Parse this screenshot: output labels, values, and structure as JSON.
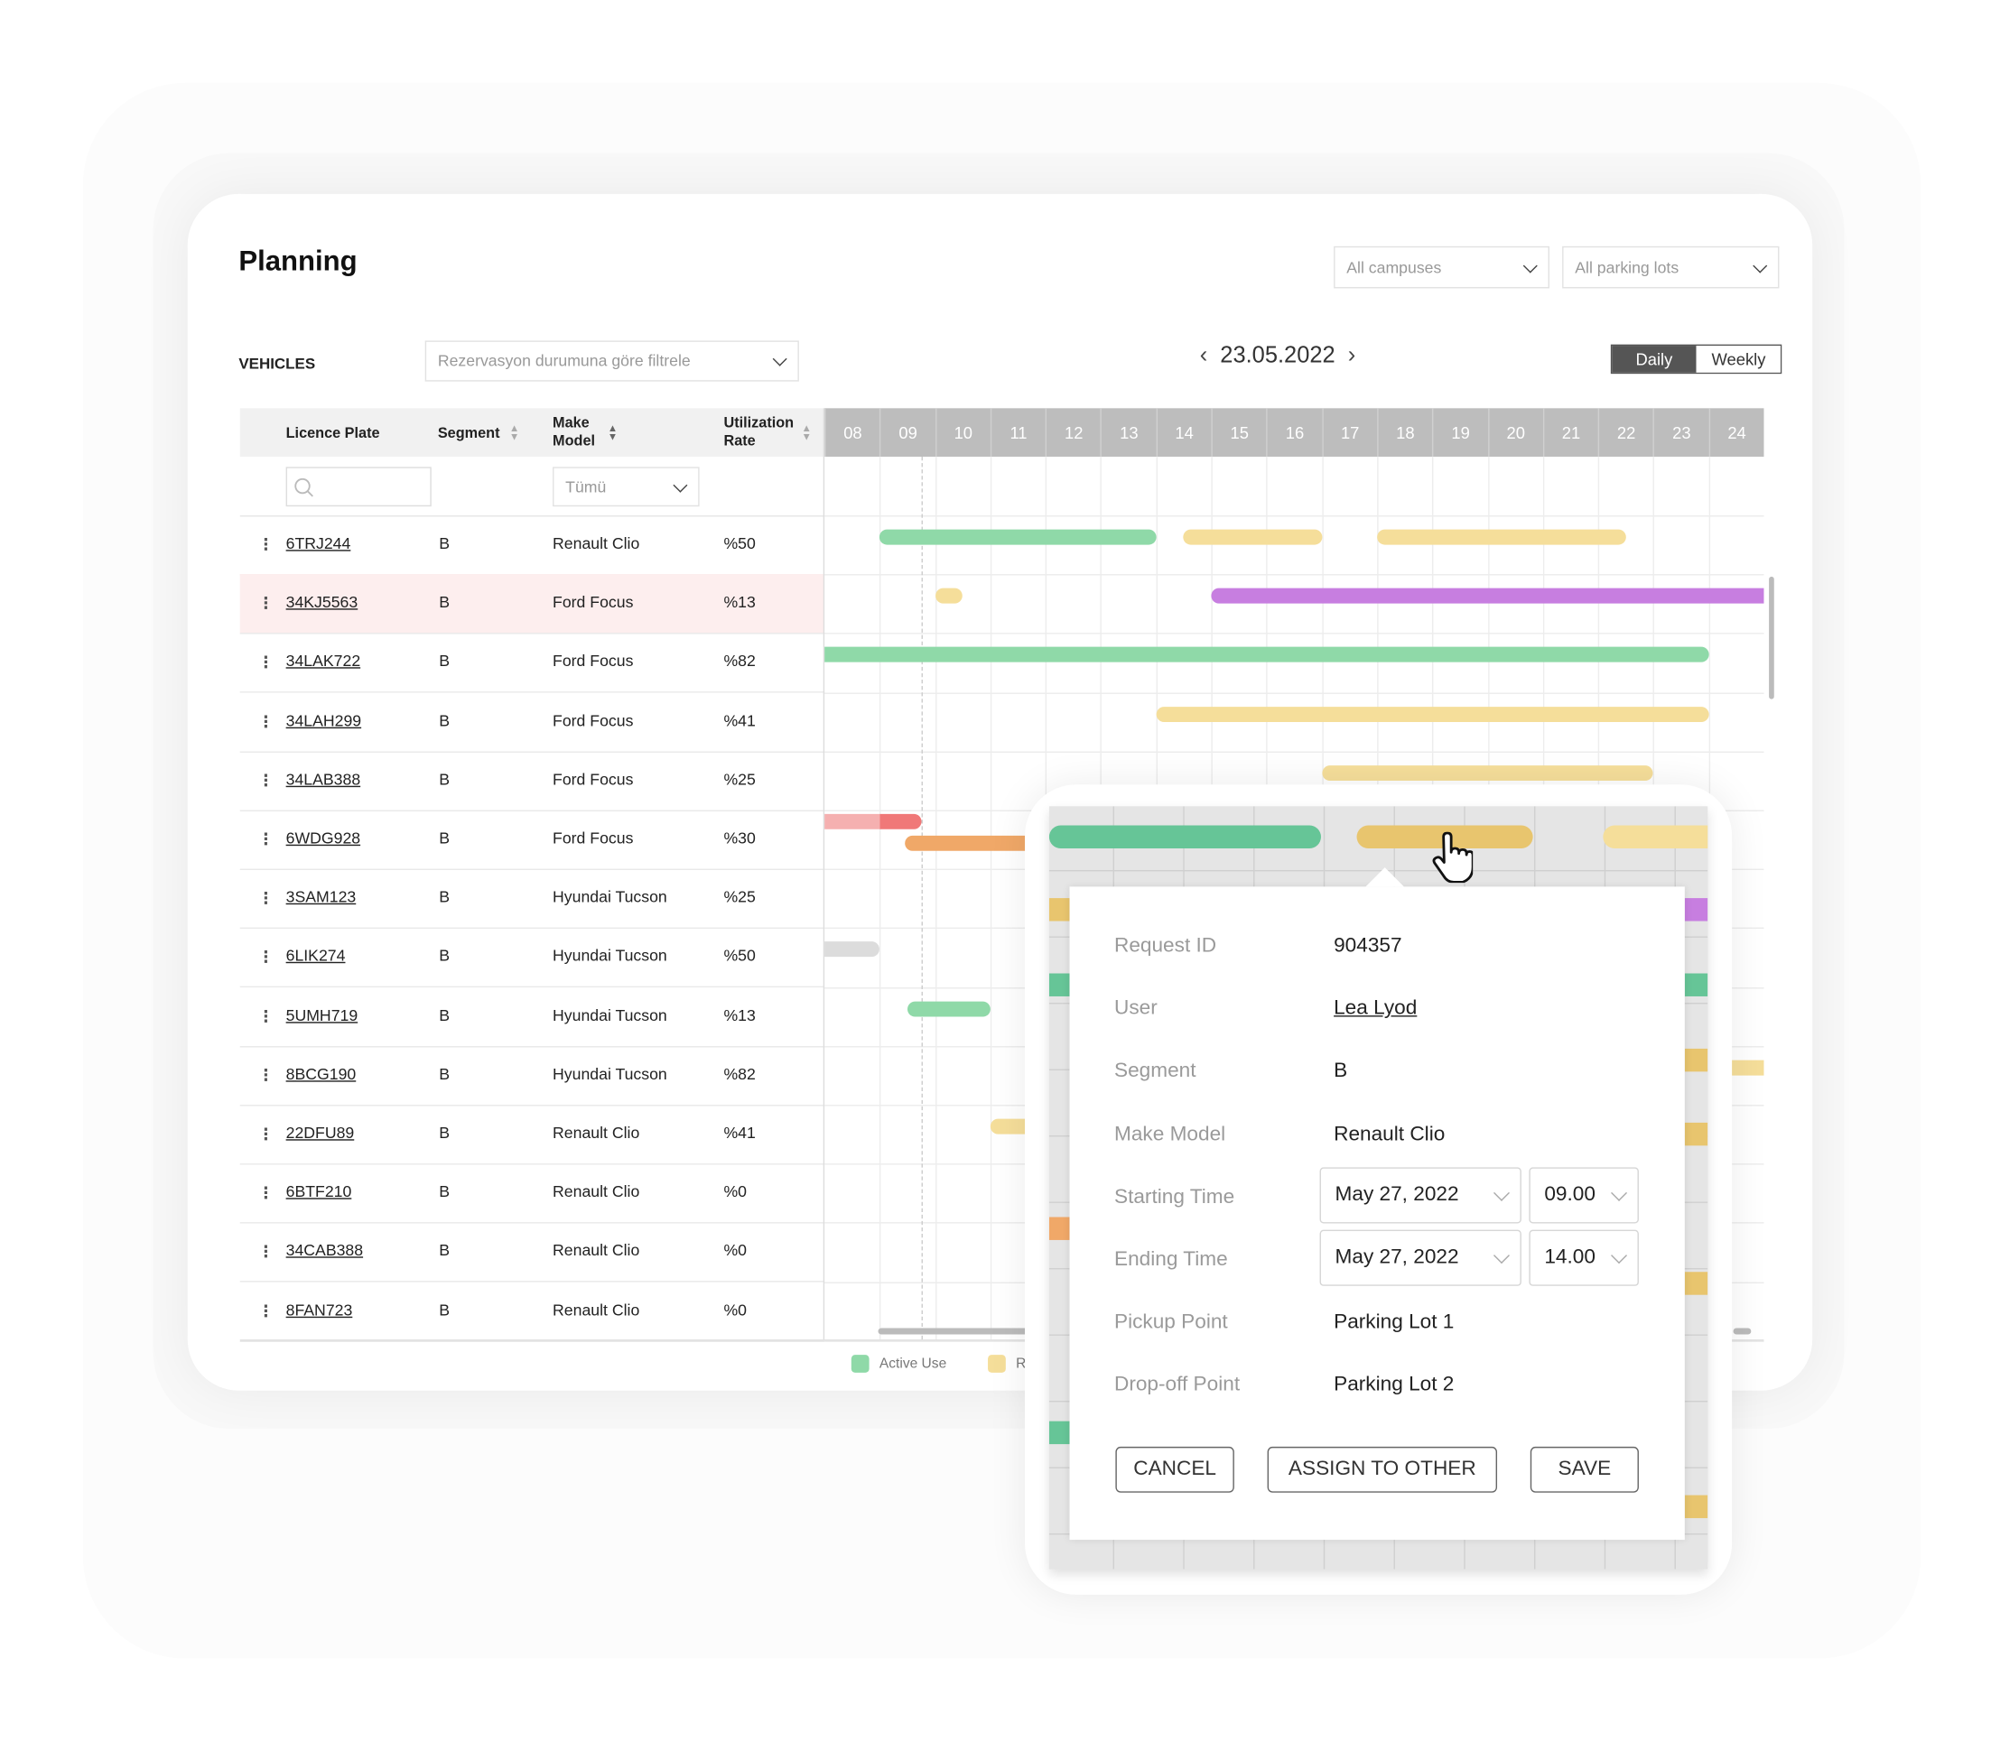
{
  "page": {
    "title": "Planning"
  },
  "filters": {
    "campus": "All campuses",
    "parking_lot": "All parking lots"
  },
  "vehicles": {
    "label": "VEHICLES",
    "status_filter_placeholder": "Rezervasyon durumuna göre filtrele"
  },
  "date_nav": {
    "date": "23.05.2022",
    "prev_icon": "chevron-left",
    "next_icon": "chevron-right"
  },
  "view_toggle": {
    "daily": "Daily",
    "weekly": "Weekly",
    "selected": "Daily"
  },
  "table": {
    "headers": {
      "plate": "Licence Plate",
      "segment": "Segment",
      "model_line1": "Make",
      "model_line2": "Model",
      "rate_line1": "Utilization",
      "rate_line2": "Rate"
    },
    "model_filter": "Tümü",
    "rows": [
      {
        "plate": "6TRJ244",
        "segment": "B",
        "model": "Renault Clio",
        "rate": "%50"
      },
      {
        "plate": "34KJ5563",
        "segment": "B",
        "model": "Ford Focus",
        "rate": "%13",
        "highlighted": true
      },
      {
        "plate": "34LAK722",
        "segment": "B",
        "model": "Ford Focus",
        "rate": "%82"
      },
      {
        "plate": "34LAH299",
        "segment": "B",
        "model": "Ford Focus",
        "rate": "%41"
      },
      {
        "plate": "34LAB388",
        "segment": "B",
        "model": "Ford Focus",
        "rate": "%25"
      },
      {
        "plate": "6WDG928",
        "segment": "B",
        "model": "Ford Focus",
        "rate": "%30"
      },
      {
        "plate": "3SAM123",
        "segment": "B",
        "model": "Hyundai Tucson",
        "rate": "%25"
      },
      {
        "plate": "6LIK274",
        "segment": "B",
        "model": "Hyundai Tucson",
        "rate": "%50"
      },
      {
        "plate": "5UMH719",
        "segment": "B",
        "model": "Hyundai Tucson",
        "rate": "%13"
      },
      {
        "plate": "8BCG190",
        "segment": "B",
        "model": "Hyundai Tucson",
        "rate": "%82"
      },
      {
        "plate": "22DFU89",
        "segment": "B",
        "model": "Renault Clio",
        "rate": "%41"
      },
      {
        "plate": "6BTF210",
        "segment": "B",
        "model": "Renault Clio",
        "rate": "%0"
      },
      {
        "plate": "34CAB388",
        "segment": "B",
        "model": "Renault Clio",
        "rate": "%0"
      },
      {
        "plate": "8FAN723",
        "segment": "B",
        "model": "Renault Clio",
        "rate": "%0"
      }
    ]
  },
  "timeline": {
    "hours": [
      "08",
      "09",
      "10",
      "11",
      "12",
      "13",
      "14",
      "15",
      "16",
      "17",
      "18",
      "19",
      "20",
      "21",
      "22",
      "23",
      "24"
    ],
    "current_time": 9.75,
    "colors": {
      "active": "#8fd9a8",
      "reserved": "#f5de9a",
      "overdue": "#f07878",
      "overdue_light": "#f5b0b0",
      "late": "#f0a868",
      "assigned": "#c77ee0",
      "idle": "#dcdcdc"
    },
    "bars": [
      {
        "row": 0,
        "start": 9,
        "end": 14,
        "status": "active"
      },
      {
        "row": 0,
        "start": 14.5,
        "end": 17,
        "status": "reserved"
      },
      {
        "row": 0,
        "start": 18,
        "end": 22.5,
        "status": "reserved"
      },
      {
        "row": 1,
        "start": 10,
        "end": 10.5,
        "status": "reserved"
      },
      {
        "row": 1,
        "start": 15,
        "end": 25,
        "status": "assigned"
      },
      {
        "row": 2,
        "start": 8,
        "end": 24,
        "status": "active"
      },
      {
        "row": 3,
        "start": 14,
        "end": 24,
        "status": "reserved"
      },
      {
        "row": 4,
        "start": 17,
        "end": 23,
        "status": "reserved"
      },
      {
        "row": 5,
        "start": 8,
        "end": 9.75,
        "status": "overdue",
        "lane": "top"
      },
      {
        "row": 5,
        "start": 9.45,
        "end": 13,
        "status": "late",
        "lane": "bottom"
      },
      {
        "row": 7,
        "start": 8,
        "end": 9,
        "status": "idle"
      },
      {
        "row": 8,
        "start": 9.5,
        "end": 11,
        "status": "active"
      },
      {
        "row": 9,
        "start": 20,
        "end": 25,
        "status": "reserved"
      },
      {
        "row": 10,
        "start": 11,
        "end": 13,
        "status": "reserved"
      }
    ]
  },
  "legend": [
    {
      "label": "Active Use",
      "color": "#8fd9a8"
    },
    {
      "label": "R",
      "color": "#f5de9a"
    }
  ],
  "popup": {
    "fields": [
      {
        "label": "Request ID",
        "value": "904357"
      },
      {
        "label": "User",
        "value": "Lea Lyod",
        "link": true
      },
      {
        "label": "Segment",
        "value": "B"
      },
      {
        "label": "Make Model",
        "value": "Renault Clio"
      },
      {
        "label": "Starting Time",
        "date": "May 27, 2022",
        "time": "09.00"
      },
      {
        "label": "Ending Time",
        "date": "May 27, 2022",
        "time": "14.00"
      },
      {
        "label": "Pickup Point",
        "value": "Parking Lot 1"
      },
      {
        "label": "Drop-off Point",
        "value": "Parking Lot 2"
      }
    ],
    "buttons": {
      "cancel": "CANCEL",
      "assign": "ASSIGN TO OTHER",
      "save": "SAVE"
    },
    "selected_bar_color": "#e8c56e"
  }
}
